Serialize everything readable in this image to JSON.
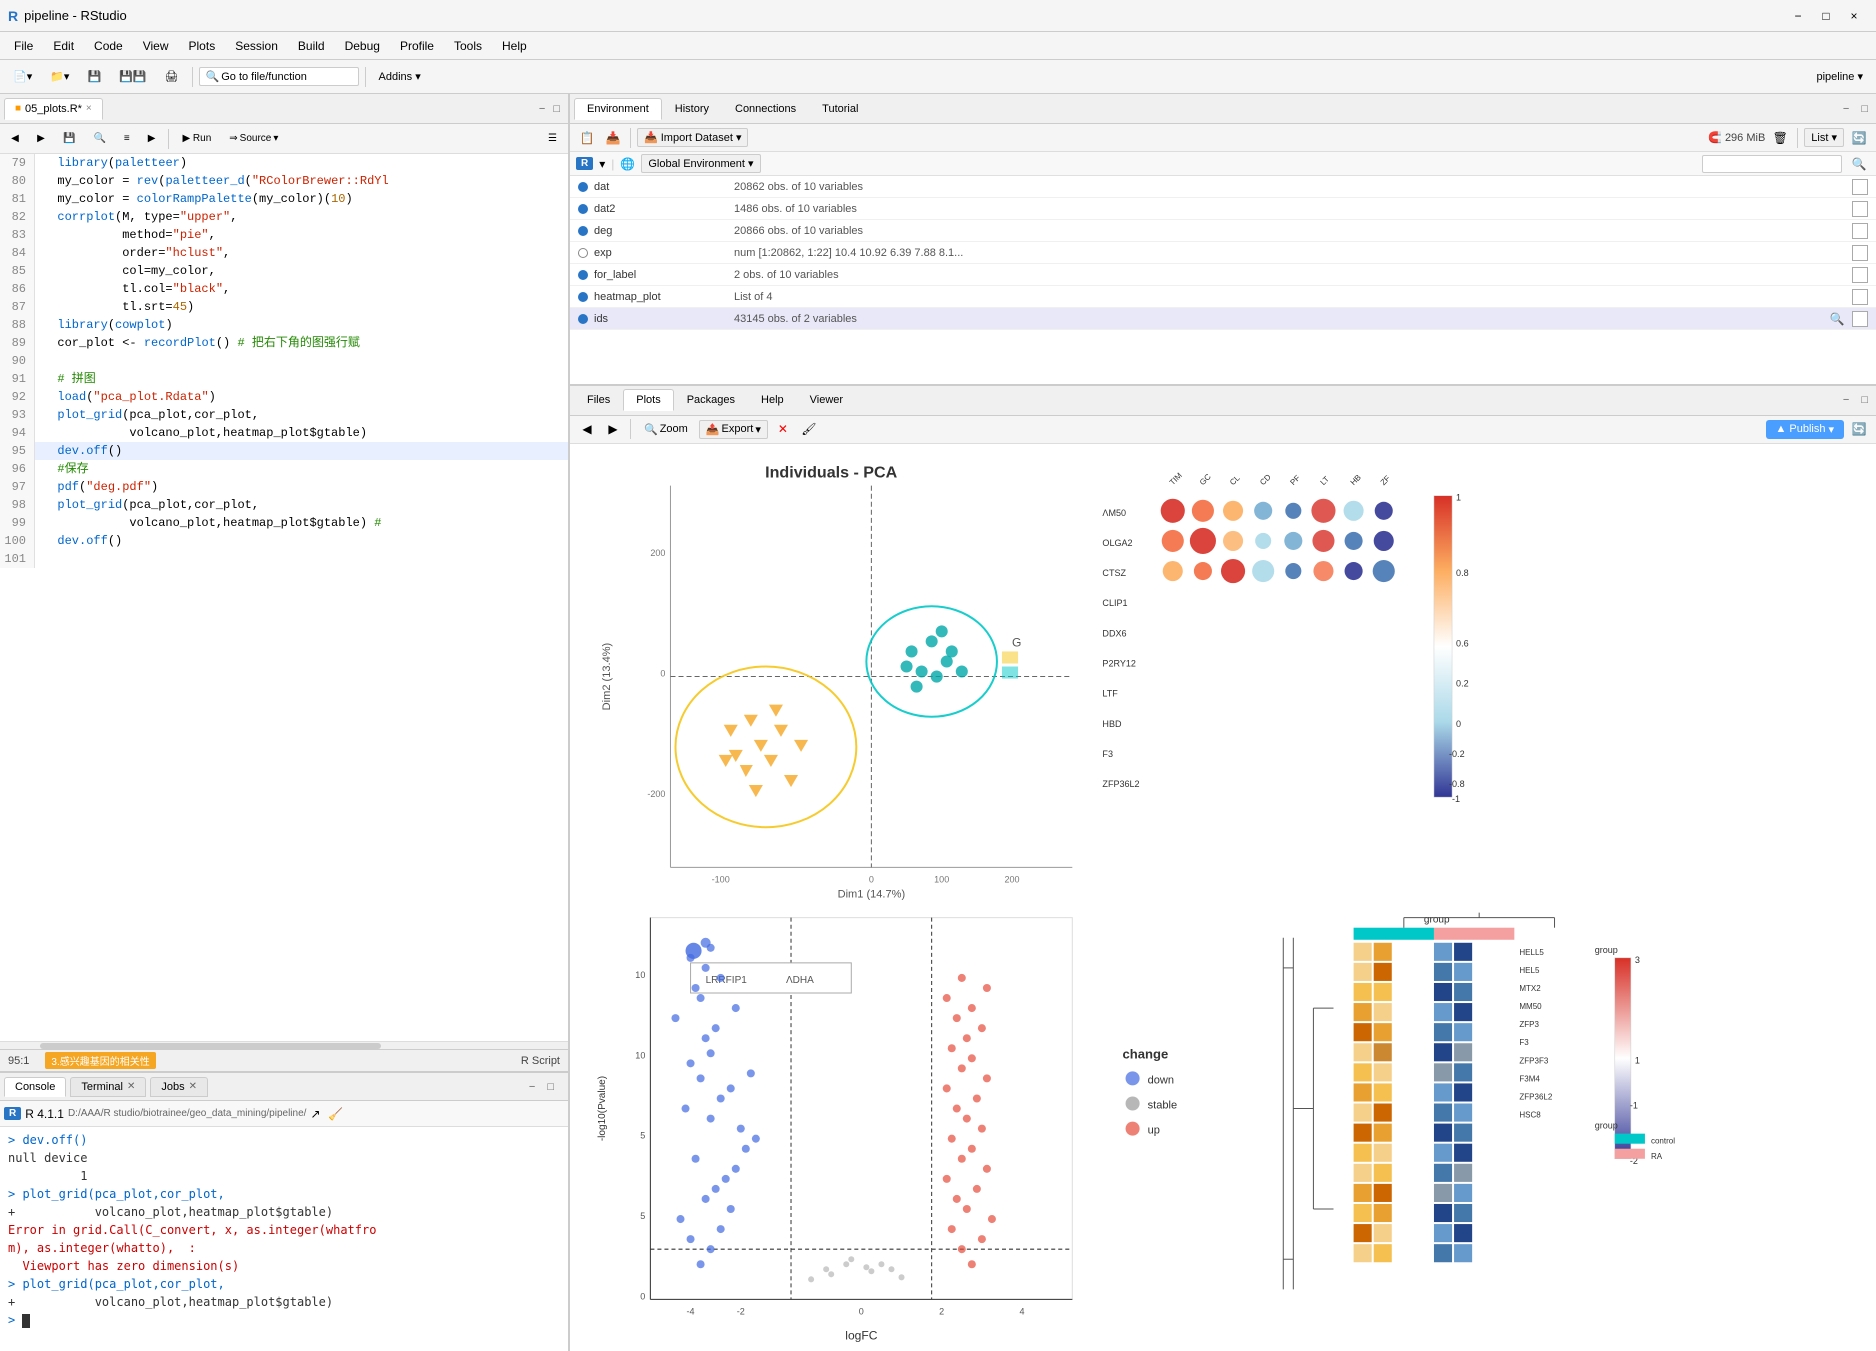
{
  "window": {
    "title": "pipeline - RStudio",
    "icon": "R"
  },
  "titlebar": {
    "title": "pipeline - RStudio",
    "minimize": "−",
    "maximize": "□",
    "close": "×"
  },
  "menubar": {
    "items": [
      "File",
      "Edit",
      "Code",
      "View",
      "Plots",
      "Session",
      "Build",
      "Debug",
      "Profile",
      "Tools",
      "Help"
    ]
  },
  "toolbar": {
    "goto_label": "Go to file/function",
    "addins_label": "Addins ▾",
    "pipeline_label": "pipeline ▾"
  },
  "editor": {
    "tab_name": "05_plots.R",
    "tab_modified": true,
    "source_btn": "Source",
    "run_btn": "Run",
    "lines": [
      {
        "num": 79,
        "content": "  library(paletteer)"
      },
      {
        "num": 80,
        "content": "  my_color = rev(paletteer_d(\"RColorBrewer::RdYl",
        "type": "code"
      },
      {
        "num": 81,
        "content": "  my_color = colorRampPalette(my_color)(10)"
      },
      {
        "num": 82,
        "content": "  corrplot(M, type=\"upper\","
      },
      {
        "num": 83,
        "content": "           method=\"pie\","
      },
      {
        "num": 84,
        "content": "           order=\"hclust\","
      },
      {
        "num": 85,
        "content": "           col=my_color,"
      },
      {
        "num": 86,
        "content": "           tl.col=\"black\","
      },
      {
        "num": 87,
        "content": "           tl.srt=45)"
      },
      {
        "num": 88,
        "content": "  library(cowplot)"
      },
      {
        "num": 89,
        "content": "  cor_plot <- recordPlot() # 把右下角的图强行赋"
      },
      {
        "num": 90,
        "content": ""
      },
      {
        "num": 91,
        "content": "  # 拼图"
      },
      {
        "num": 92,
        "content": "  load(\"pca_plot.Rdata\")"
      },
      {
        "num": 93,
        "content": "  plot_grid(pca_plot,cor_plot,"
      },
      {
        "num": 94,
        "content": "            volcano_plot,heatmap_plot$gtable)"
      },
      {
        "num": 95,
        "content": "  dev.off()",
        "active": true
      },
      {
        "num": 96,
        "content": "  #保存"
      },
      {
        "num": 97,
        "content": "  pdf(\"deg.pdf\")"
      },
      {
        "num": 98,
        "content": "  plot_grid(pca_plot,cor_plot,"
      },
      {
        "num": 99,
        "content": "            volcano_plot,heatmap_plot$gtable) #"
      },
      {
        "num": 100,
        "content": "  dev.off()"
      },
      {
        "num": 101,
        "content": ""
      }
    ],
    "statusbar": {
      "position": "95:1",
      "section": "3.感兴趣基因的相关性",
      "type": "R Script"
    }
  },
  "environment": {
    "tabs": [
      "Environment",
      "History",
      "Connections",
      "Tutorial"
    ],
    "active_tab": "Environment",
    "memory": "296 MiB",
    "list_btn": "List",
    "r_label": "R",
    "global_env": "Global Environment",
    "search_placeholder": "",
    "variables": [
      {
        "name": "dat",
        "desc": "20862 obs. of  10 variables",
        "color": "#2874c5"
      },
      {
        "name": "dat2",
        "desc": "1486 obs. of  10 variables",
        "color": "#2874c5"
      },
      {
        "name": "deg",
        "desc": "20866 obs. of  10 variables",
        "color": "#2874c5"
      },
      {
        "name": "exp",
        "desc": "num [1:20862, 1:22] 10.4 10.92 6.39 7.88 8.1...",
        "color": "none"
      },
      {
        "name": "for_label",
        "desc": "2 obs. of  10 variables",
        "color": "#2874c5"
      },
      {
        "name": "heatmap_plot",
        "desc": "List of  4",
        "color": "#2874c5"
      },
      {
        "name": "ids",
        "desc": "43145 obs. of  2 variables",
        "color": "#2874c5"
      }
    ]
  },
  "plots": {
    "tabs": [
      "Files",
      "Plots",
      "Packages",
      "Help",
      "Viewer"
    ],
    "active_tab": "Plots",
    "zoom_label": "Zoom",
    "export_label": "Export",
    "publish_label": "Publish"
  },
  "console": {
    "tabs": [
      "Console",
      "Terminal",
      "Jobs"
    ],
    "active_tab": "Console",
    "r_version": "R 4.1.1",
    "path": "D:/AAA/R studio/biotrainee/geo_data_mining/pipeline/",
    "lines": [
      {
        "text": "> dev.off()",
        "class": "console-prompt"
      },
      {
        "text": "null device",
        "class": "console-output"
      },
      {
        "text": "          1",
        "class": "console-output"
      },
      {
        "text": "> plot_grid(pca_plot,cor_plot,",
        "class": "console-prompt"
      },
      {
        "text": "+           volcano_plot,heatmap_plot$gtable)",
        "class": "console-output"
      },
      {
        "text": "Error in grid.Call(C_convert, x, as.integer(whatfro",
        "class": "console-error"
      },
      {
        "text": "m), as.integer(whatto),  :",
        "class": "console-error"
      },
      {
        "text": "  Viewport has zero dimension(s)",
        "class": "console-error"
      },
      {
        "text": "> plot_grid(pca_plot,cor_plot,",
        "class": "console-prompt"
      },
      {
        "text": "+           volcano_plot,heatmap_plot$gtable)",
        "class": "console-output"
      },
      {
        "text": "> ",
        "class": "console-prompt"
      }
    ]
  }
}
